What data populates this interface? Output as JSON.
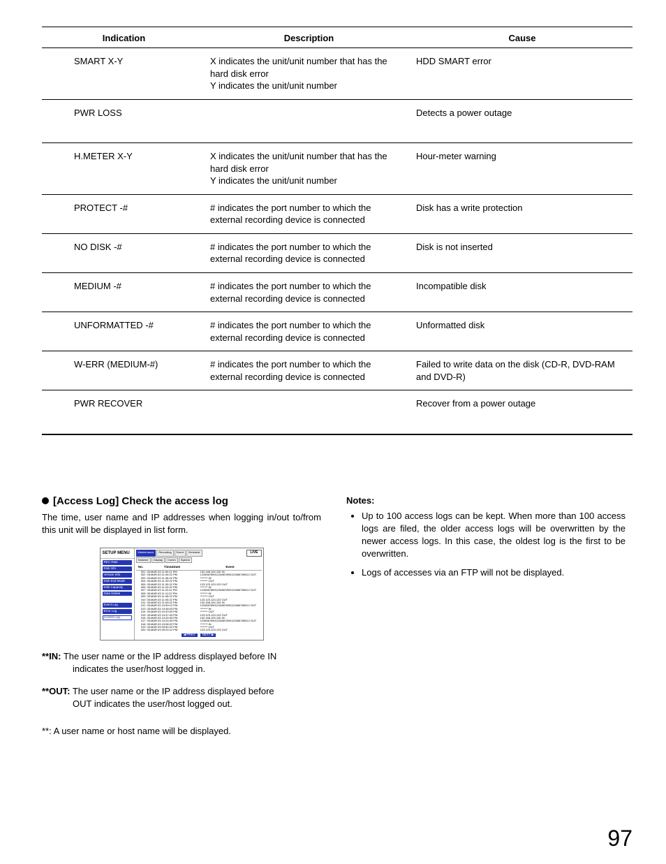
{
  "table": {
    "headers": [
      "Indication",
      "Description",
      "Cause"
    ],
    "rows": [
      {
        "indication": "SMART X-Y",
        "description": "X indicates the unit/unit number that has the hard disk error\nY indicates the unit/unit number",
        "cause": "HDD SMART error",
        "tall": false
      },
      {
        "indication": "PWR LOSS",
        "description": "",
        "cause": "Detects a power outage",
        "tall": true
      },
      {
        "indication": "H.METER X-Y",
        "description": "X indicates the unit/unit number that has the hard disk error\nY indicates the unit/unit number",
        "cause": "Hour-meter warning",
        "tall": false
      },
      {
        "indication": "PROTECT -#",
        "description": "# indicates the port number to which the external recording device is connected",
        "cause": "Disk has a write protection",
        "tall": false
      },
      {
        "indication": "NO DISK -#",
        "description": "# indicates the port number to which the external recording device is connected",
        "cause": "Disk is not inserted",
        "tall": false
      },
      {
        "indication": "MEDIUM -#",
        "description": "# indicates the port number to which the external recording device is connected",
        "cause": "Incompatible disk",
        "tall": false
      },
      {
        "indication": "UNFORMATTED -#",
        "description": "# indicates the port number to which the external recording device is connected",
        "cause": "Unformatted disk",
        "tall": false
      },
      {
        "indication": "W-ERR (MEDIUM-#)",
        "description": "# indicates the port number to which the external recording device is connected",
        "cause": "Failed to write data on the disk (CD-R, DVD-RAM and DVD-R)",
        "tall": false
      },
      {
        "indication": "PWR RECOVER",
        "description": "",
        "cause": "Recover from a power outage",
        "tall": true
      }
    ]
  },
  "section": {
    "heading": "[Access Log] Check the access log",
    "intro": "The time, user name and IP addresses when logging in/out to/from this unit will be displayed in list form.",
    "in_label": "**IN:",
    "in_text_first": " The user name or the IP address displayed before IN",
    "in_text_rest": "indicates the user/host logged in.",
    "out_label": "**OUT:",
    "out_text_first": " The user name or the IP address displayed before",
    "out_text_rest": "OUT indicates the user/host logged out.",
    "footnote": "**: A user name or host name will be displayed."
  },
  "notes": {
    "heading": "Notes:",
    "items": [
      "Up to 100 access logs can be kept. When more than 100 access logs are filed, the older access logs will be overwritten by the newer access logs. In this case, the oldest log is the first to be overwritten.",
      "Logs of accesses via an FTP will not be displayed."
    ]
  },
  "mock": {
    "title": "SETUP MENU",
    "tabs_row1": [
      "Maintenance",
      "Recording",
      "Event",
      "Schedule"
    ],
    "tabs_row2": [
      "Switcher",
      "Display",
      "Comm",
      "System"
    ],
    "live": "LIVE",
    "side_group1": [
      "REC Rate",
      "Disk Info",
      "Version Info",
      "Disk End Mode",
      "Disk Capacity",
      "Data Delete"
    ],
    "side_group2": [
      "Event Log",
      "Error Log"
    ],
    "side_selected": "Access Log",
    "log_headers": {
      "no": "No.",
      "time": "Time&Date",
      "event": "Event"
    },
    "log_rows": [
      {
        "n": "001",
        "t": "05.MAR.03 11:50:11 PM",
        "e": "192.168.100.100 IN"
      },
      {
        "n": "002",
        "t": "05.MAR.03 11:49:22 PM",
        "e": "12345678901234567890123456789012 OUT"
      },
      {
        "n": "003",
        "t": "05.MAR.03 11:36:22 PM",
        "e": "******* IN"
      },
      {
        "n": "004",
        "t": "05.MAR.03 11:33:22 PM",
        "e": "******* OUT"
      },
      {
        "n": "005",
        "t": "05.MAR.03 11:30:22 PM",
        "e": "123.123.123.123 OUT"
      },
      {
        "n": "006",
        "t": "05.MAR.03 11:20:22 PM",
        "e": "******* IN"
      },
      {
        "n": "007",
        "t": "05.MAR.03 11:20:11 PM",
        "e": "12345678901234567890123456789012 OUT"
      },
      {
        "n": "008",
        "t": "05.MAR.03 11:11:22 PM",
        "e": "******* IN"
      },
      {
        "n": "009",
        "t": "05.MAR.03 11:08:22 PM",
        "e": "******* OUT"
      },
      {
        "n": "010",
        "t": "05.MAR.03 11:05:22 PM",
        "e": "123.123.123.123 OUT"
      },
      {
        "n": "011",
        "t": "05.MAR.03 11:03:02 PM",
        "e": "192.168.100.100 IN"
      },
      {
        "n": "012",
        "t": "05.MAR.03 10:59:12 PM",
        "e": "12345678901234567890123456789012 OUT"
      },
      {
        "n": "013",
        "t": "05.MAR.03 10:48:03 PM",
        "e": "******* IN"
      },
      {
        "n": "014",
        "t": "05.MAR.03 10:43:03 PM",
        "e": "******* OUT"
      },
      {
        "n": "015",
        "t": "05.MAR.03 10:37:03 PM",
        "e": "123.123.123.123 OUT"
      },
      {
        "n": "016",
        "t": "05.MAR.03 10:30:03 PM",
        "e": "192.168.100.100 IN"
      },
      {
        "n": "017",
        "t": "05.MAR.03 10:24:03 PM",
        "e": "12345678901234567890123456789012 OUT"
      },
      {
        "n": "018",
        "t": "05.MAR.03 10:08:22 PM",
        "e": "******* IN"
      },
      {
        "n": "019",
        "t": "05.MAR.03 09:50:22 PM",
        "e": "******* OUT"
      },
      {
        "n": "020",
        "t": "05.MAR.03 09:24:12 PM",
        "e": "123.123.123.123 OUT"
      }
    ],
    "pager_prev": "◀ PREV",
    "pager_next": "NEXT ▶"
  },
  "page_number": "97"
}
